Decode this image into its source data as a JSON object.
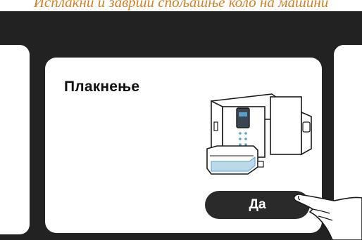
{
  "instruction_caption": "Исплакни и заврши спољашње коло на машини",
  "dialog": {
    "title": "Плакнење",
    "confirm_label": "Да"
  },
  "icons": {
    "illustration": "coffee-machine-rinse-illustration",
    "pointer": "hand-pointer-icon"
  },
  "colors": {
    "caption": "#c8842e",
    "screen_bg": "#222222",
    "button_bg": "#2a2a2a",
    "water": "#5aa0c8"
  }
}
